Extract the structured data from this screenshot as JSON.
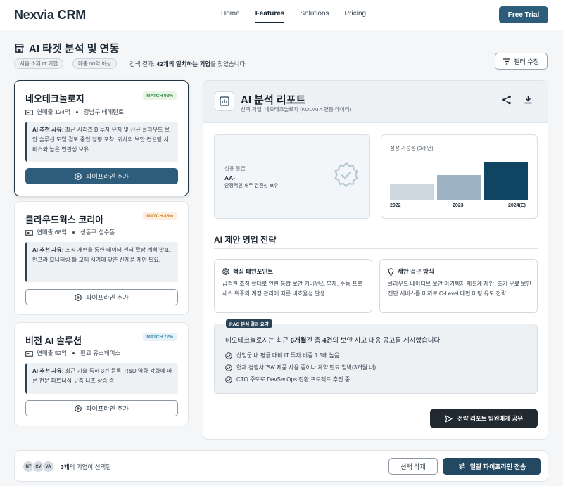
{
  "app": {
    "logo": "Nexvia CRM",
    "trial_label": "Free Trial"
  },
  "nav": {
    "items": [
      "Home",
      "Features",
      "Solutions",
      "Pricing"
    ],
    "active": "Features"
  },
  "page": {
    "title": "AI 타겟 분석 및 연동",
    "chips": [
      "서울 소재 IT 기업",
      "매출 50억 이상"
    ],
    "result_prefix": "검색 결과: ",
    "result_bold": "42개의 일치하는 기업",
    "result_suffix": "을 찾았습니다.",
    "filter_label": "필터 수정"
  },
  "companies": [
    {
      "name": "네오테크놀로지",
      "match": "MATCH 98%",
      "revenue": "연매출 124억",
      "location": "강남구 테헤란로",
      "reason_label": "AI 추천 사유:",
      "reason": " 최근 시리즈 B 투자 유치 및 신규 클라우드 보안 솔루션 도입 검토 중인 정황 포착. 귀사의 보안 컨설팅 서비스와 높은 연관성 보유.",
      "button": "파이프라인 추가"
    },
    {
      "name": "클라우드웍스 코리아",
      "match": "MATCH 85%",
      "revenue": "연매출 68억",
      "location": "성동구 성수동",
      "reason_label": "AI 추천 사유:",
      "reason": " 조직 개편을 통한 데이터 센터 확장 계획 발표. 인프라 모니터링 툴 교체 시기에 맞춘 신제품 제안 필요.",
      "button": "파이프라인 추가"
    },
    {
      "name": "비전 AI 솔루션",
      "match": "MATCH 72%",
      "revenue": "연매출 52억",
      "location": "판교 유스페이스",
      "reason_label": "AI 추천 사유:",
      "reason": " 최근 기술 특허 3건 등록. R&D 역량 강화에 따른 전문 파트너십 구축 니즈 상승 중.",
      "button": "파이프라인 추가"
    }
  ],
  "report": {
    "title": "AI 분석 리포트",
    "subtitle": "선택 기업: 네오테크놀로지 (KODATA 연동 데이터)",
    "credit_label": "신용 등급",
    "credit_value": "AA-",
    "credit_desc": "안정적인 재무 건전성 보유",
    "growth_title": "성장 가능성 (3개년)",
    "strategy_title": "AI 제안 영업 전략",
    "pain_title": "핵심 페인포인트",
    "pain_body": "급격한 조직 확대로 인한 통합 보안 거버넌스 부재. 수동 프로세스 위주의 계정 관리에 따른 비효율성 발생.",
    "approach_title": "제안 접근 방식",
    "approach_body": "클라우드 네이티브 보안 아키텍처 재설계 제안. 초기 무료 보안 진단 서비스를 미끼로 C-Level 대면 미팅 유도 전략.",
    "rag_tag": "RAG 분석 결과 요약",
    "rag_head_1": "네오테크놀로지는 최근 ",
    "rag_head_b1": "6개월",
    "rag_head_2": "간 총 ",
    "rag_head_b2": "4건",
    "rag_head_3": "의 보안 사고 대응 공고를 게시했습니다.",
    "rag_items": [
      "산업군 내 평균 대비 IT 투자 비중 1.5배 높음",
      "현재 경쟁사 'SA' 제품 사용 중이나 계약 만료 임박(3개월 내)",
      "CTO 주도로 DevSecOps 전환 프로젝트 추진 중"
    ],
    "share_label": "전략 리포트 팀원에게 공유"
  },
  "chart_data": {
    "type": "bar",
    "title": "성장 가능성 (3개년)",
    "categories": [
      "2022",
      "2023",
      "2024(E)"
    ],
    "values": [
      40,
      65,
      100
    ],
    "colors": [
      "#cdd8e1",
      "#9db3c3",
      "#0f4563"
    ],
    "ylim": [
      0,
      100
    ]
  },
  "bottom": {
    "avatars": [
      "NT",
      "CV",
      "VA"
    ],
    "count_bold": "3개",
    "count_suffix": "의 기업이 선택됨",
    "delete_label": "선택 삭제",
    "bulk_label": "일괄 파이프라인 전송"
  },
  "colors": {
    "primary": "#2e5d7b",
    "dark": "#222a31",
    "accent_dark": "#224862"
  }
}
